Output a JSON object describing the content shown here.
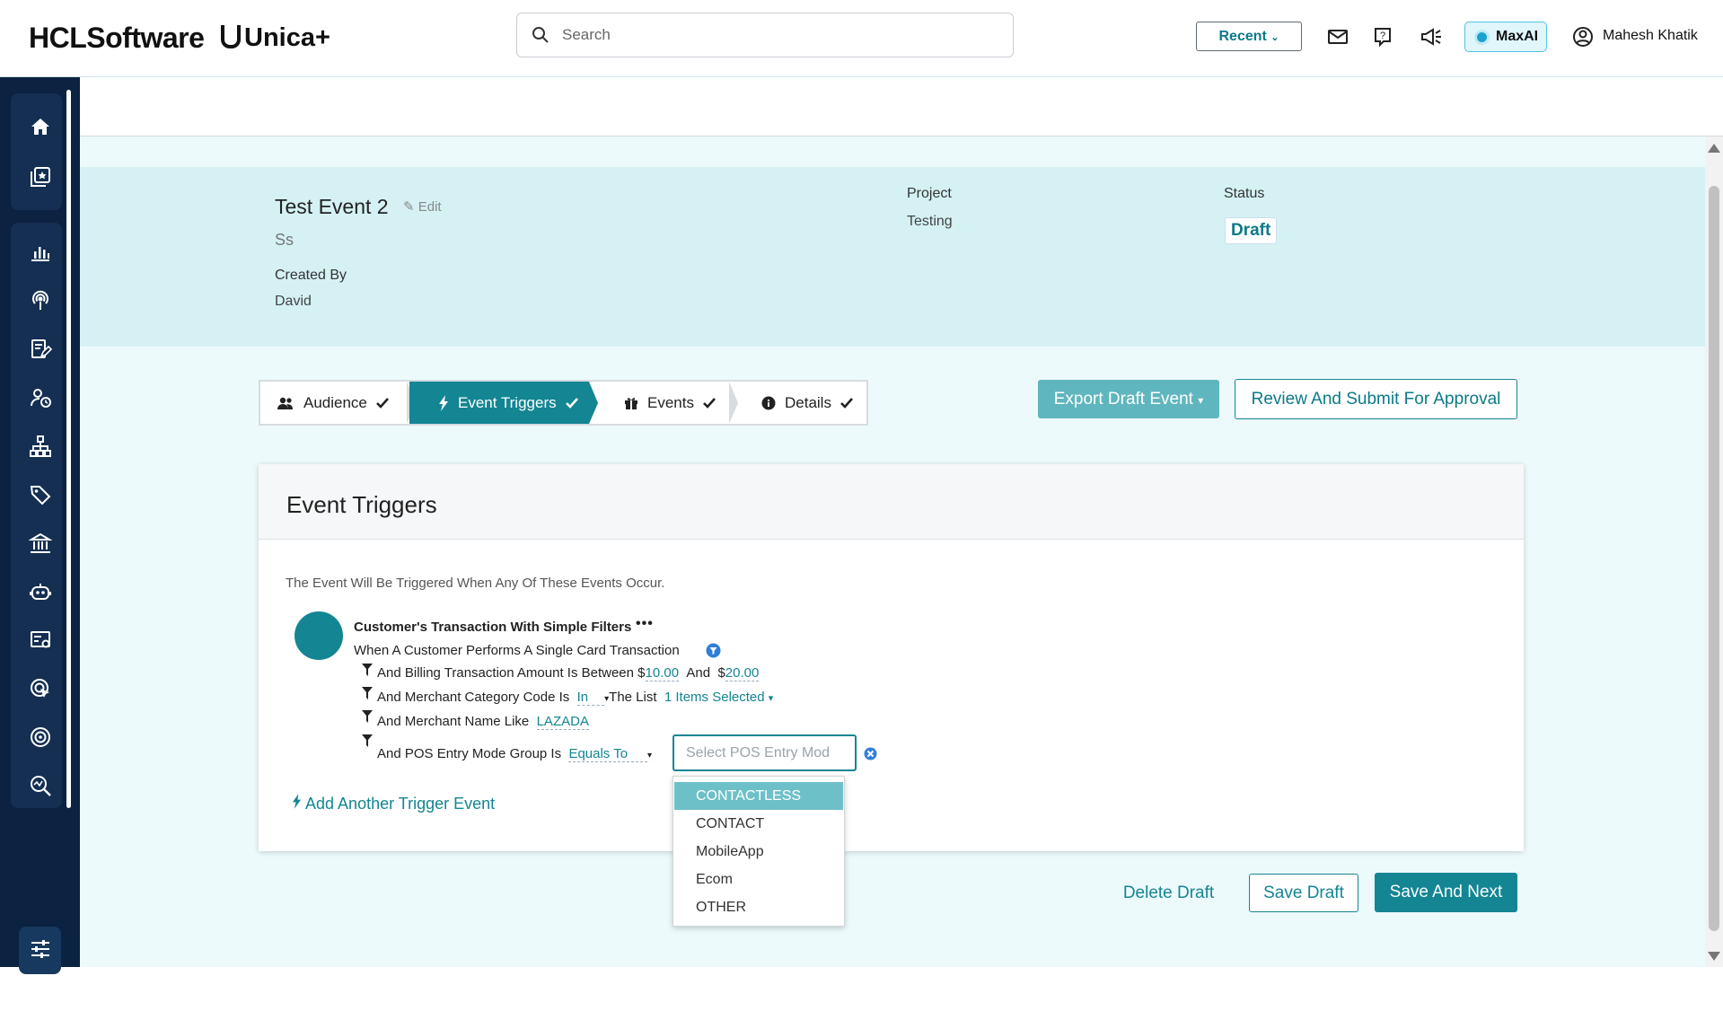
{
  "brand": {
    "company": "HCLSoftware",
    "product": "Unica+"
  },
  "search": {
    "placeholder": "Search"
  },
  "header": {
    "recent_label": "Recent",
    "maxai_label": "MaxAI",
    "user_name": "Mahesh Khatik"
  },
  "event": {
    "title": "Test Event 2",
    "edit_label": "Edit",
    "description": "Ss",
    "created_by_label": "Created By",
    "created_by": "David",
    "project_label": "Project",
    "project": "Testing",
    "status_label": "Status",
    "status": "Draft"
  },
  "steps": [
    {
      "label": "Audience"
    },
    {
      "label": "Event Triggers"
    },
    {
      "label": "Events"
    },
    {
      "label": "Details"
    }
  ],
  "actions": {
    "export_label": "Export Draft Event",
    "review_label": "Review And Submit For Approval",
    "delete_label": "Delete Draft",
    "save_draft_label": "Save Draft",
    "save_next_label": "Save And Next"
  },
  "card": {
    "title": "Event Triggers",
    "intro": "The Event Will Be Triggered When Any Of These Events Occur.",
    "rule_title": "Customer's Transaction With Simple Filters",
    "rule_subtitle": "When A Customer Performs A Single Card Transaction",
    "cond1": {
      "text": "And Billing Transaction Amount Is Between",
      "cur1": "$",
      "v1": "10.00",
      "and": "And",
      "cur2": "$",
      "v2": "20.00"
    },
    "cond2": {
      "text": "And Merchant Category Code Is",
      "op": "In",
      "mid": "The List",
      "selected": "1 Items Selected"
    },
    "cond3": {
      "text": "And Merchant Name Like",
      "value": "LAZADA"
    },
    "cond4": {
      "text": "And POS Entry Mode Group Is",
      "op": "Equals To",
      "placeholder": "Select POS Entry Mod"
    },
    "add_trigger_label": "Add Another Trigger Event"
  },
  "pos_options": [
    "CONTACTLESS",
    "CONTACT",
    "MobileApp",
    "Ecom",
    "OTHER"
  ],
  "colors": {
    "accent": "#138593",
    "sidebar": "#0b2240",
    "band": "#d5f1f4"
  }
}
